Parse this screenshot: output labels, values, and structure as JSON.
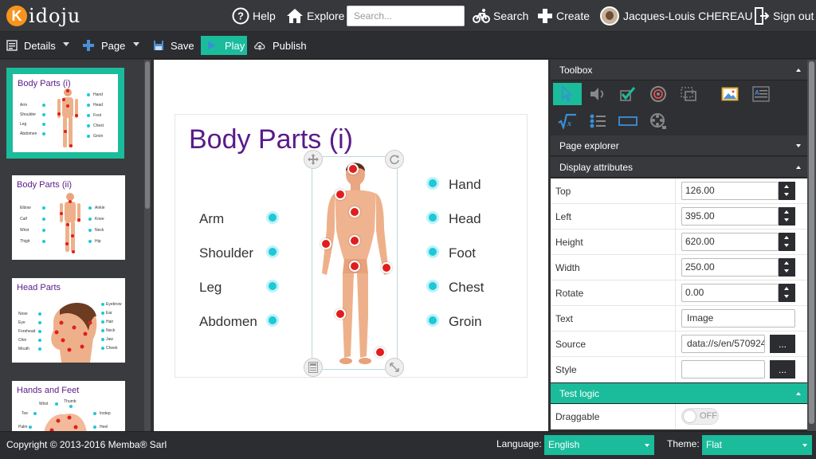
{
  "app": {
    "logo_text": "idoju",
    "logo_letter": "K"
  },
  "nav": {
    "help": "Help",
    "explore": "Explore",
    "search_placeholder": "Search...",
    "search_button": "Search",
    "create": "Create",
    "user_name": "Jacques-Louis CHEREAU",
    "sign_out": "Sign out"
  },
  "toolbar": {
    "details": "Details",
    "page": "Page",
    "save": "Save",
    "play": "Play",
    "publish": "Publish"
  },
  "thumbnails": [
    {
      "title": "Body Parts (i)",
      "left_labels": [
        "Arm",
        "Shoulder",
        "Leg",
        "Abdomen"
      ],
      "right_labels": [
        "Hand",
        "Head",
        "Foot",
        "Chest",
        "Groin"
      ],
      "active": true
    },
    {
      "title": "Body Parts (ii)",
      "left_labels": [
        "Elbow",
        "Calf",
        "Wrist",
        "Thigh"
      ],
      "right_labels": [
        "Ankle",
        "Knee",
        "Neck",
        "Hip"
      ],
      "active": false
    },
    {
      "title": "Head Parts",
      "left_labels": [
        "Nose",
        "Eye",
        "Forehead",
        "Chin",
        "Mouth"
      ],
      "right_labels": [
        "Eyebrow",
        "Ear",
        "Hair",
        "Neck",
        "Jaw",
        "Cheek"
      ],
      "active": false
    },
    {
      "title": "Hands and Feet",
      "left_labels": [
        "Wrist",
        "Thumb",
        "Toe",
        "Palm"
      ],
      "right_labels": [
        "Instep",
        "Heel"
      ],
      "active": false
    }
  ],
  "stage": {
    "title": "Body Parts (i)",
    "left_labels": [
      "Arm",
      "Shoulder",
      "Leg",
      "Abdomen"
    ],
    "right_labels": [
      "Hand",
      "Head",
      "Foot",
      "Chest",
      "Groin"
    ]
  },
  "panel": {
    "toolbox": "Toolbox",
    "page_explorer": "Page explorer",
    "display_attributes": "Display attributes",
    "test_logic": "Test logic",
    "attributes": {
      "top_label": "Top",
      "top_value": "126.00",
      "left_label": "Left",
      "left_value": "395.00",
      "height_label": "Height",
      "height_value": "620.00",
      "width_label": "Width",
      "width_value": "250.00",
      "rotate_label": "Rotate",
      "rotate_value": "0.00",
      "text_label": "Text",
      "text_value": "Image",
      "source_label": "Source",
      "source_value": "data://s/en/570924",
      "style_label": "Style",
      "style_value": "",
      "browse_label": "...",
      "draggable_label": "Draggable",
      "draggable_value": "OFF"
    }
  },
  "footer": {
    "copyright": "Copyright © 2013-2016 Memba® Sarl",
    "language_label": "Language:",
    "language_value": "English",
    "theme_label": "Theme:",
    "theme_value": "Flat"
  },
  "colors": {
    "accent": "#1abc9c",
    "title_purple": "#5a1a8a",
    "radio_cyan": "#1ec8d8",
    "marker_red": "#e21d1d",
    "logo_orange": "#f7941d"
  }
}
